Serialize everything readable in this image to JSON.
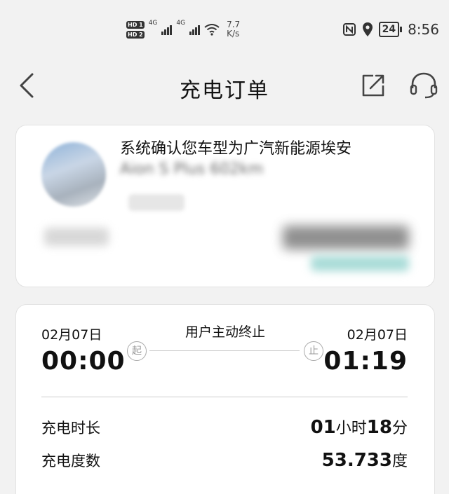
{
  "status_bar": {
    "hd1": "HD 1",
    "hd2": "HD 2",
    "net1": "4G",
    "net2": "4G",
    "speed_value": "7.7",
    "speed_unit": "K/s",
    "battery": "24",
    "time": "8:56"
  },
  "header": {
    "title": "充电订单"
  },
  "vehicle": {
    "message": "系统确认您车型为广汽新能源埃安",
    "model": "Aion S Plus 602km"
  },
  "charge": {
    "start_date": "02月07日",
    "start_time": "00:00",
    "start_marker": "起",
    "stop_reason": "用户主动终止",
    "end_marker": "止",
    "end_date": "02月07日",
    "end_time": "01:19",
    "duration_label": "充电时长",
    "duration_hours": "01",
    "duration_hours_unit": "小时",
    "duration_minutes": "18",
    "duration_minutes_unit": "分",
    "energy_label": "充电度数",
    "energy_value": "53.733",
    "energy_unit": "度"
  }
}
